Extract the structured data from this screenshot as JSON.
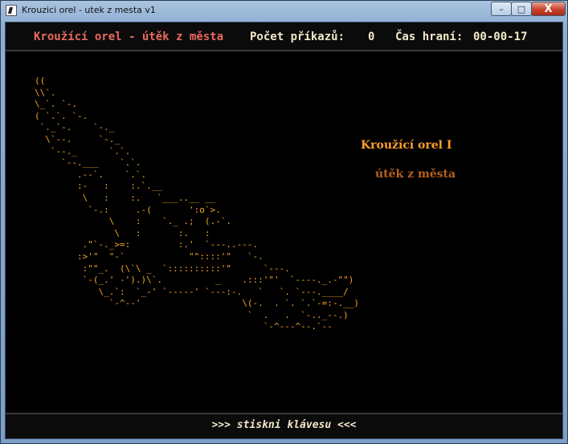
{
  "window": {
    "title": "Krouzici orel - utek z mesta v1",
    "controls": {
      "minimize": "–",
      "maximize": "□",
      "close": "X"
    }
  },
  "header": {
    "game_title": "Kroužící orel - útěk z města",
    "commands_label": "Počet příkazů:",
    "commands_value": "0",
    "time_label": "Čas hraní:",
    "time_value": "00-00-17"
  },
  "scene": {
    "ascii_art": "((\n\\\\`.\n\\_`. `-.\n( `.`. `-.\n `._`-.    `-._\n  \\`--.     `-._\n   `--._      `.`.\n     `--.___    `.`.\n        .--`.    `.`.\n        :-   :    :.`.__\n         \\   :    :.   `___..__ __\n          `-.:     .-(       ':o`>.\n              \\    :    `._ .;  (.-`.\n               \\   :       :.   :\n         .\"`-._>=:         :.'  `---..---.\n        :>'\"  \"-`            \"\"::::'\"   `-.\n         :\"\"_.  (\\`\\ _  `::::::::::'\"      `---.\n         `-(_.' -').)\\`.          _    .:::'\"'  `----._.-\"\")\n            \\_.`:  `_-' `-----' `---:-.   `   `. `---.____/\n              `-^--'                   \\(-.  . `. `.`-=:-.__)\n                                        `  .   .  `-.._--.)\n                                           `-^---^--.`--",
    "title": "Kroužící orel I",
    "subtitle": "útěk z města"
  },
  "footer": {
    "prompt": ">>> stiskni klávesu <<<"
  },
  "colors": {
    "game_title": "#ea6a5e",
    "header_text": "#f2e9c8",
    "art": "#f5a623",
    "art_title": "#ff9f2a",
    "art_subtitle": "#b8601e",
    "background": "#000000"
  }
}
